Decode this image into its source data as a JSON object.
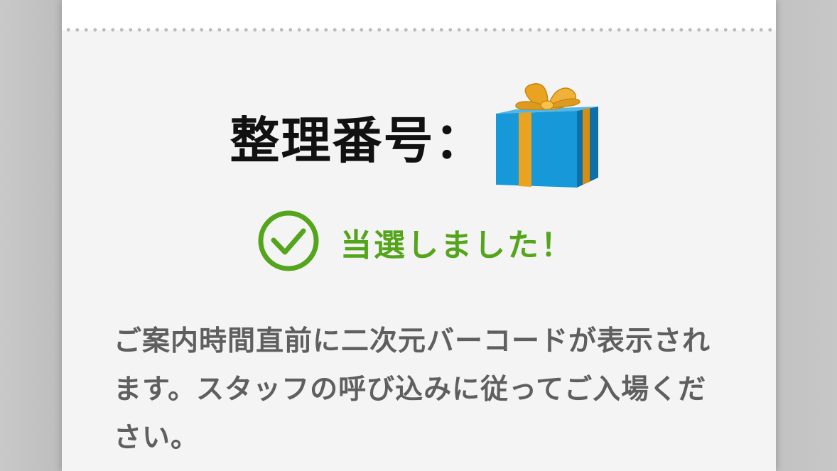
{
  "ticket": {
    "number_label": "整理番号：",
    "number_icon": "gift-icon",
    "status_icon": "check-circle-icon",
    "status_text": "当選しました！",
    "notice_text": "ご案内時間直前に二次元バーコードが表示されます。スタッフの呼び込みに従ってご入場ください。"
  },
  "colors": {
    "status_green": "#55a51c",
    "gift_box_blue": "#1798d8",
    "gift_ribbon_gold": "#e9a321",
    "card_background": "#f4f4f4",
    "notice_text": "#5f5f5f"
  }
}
